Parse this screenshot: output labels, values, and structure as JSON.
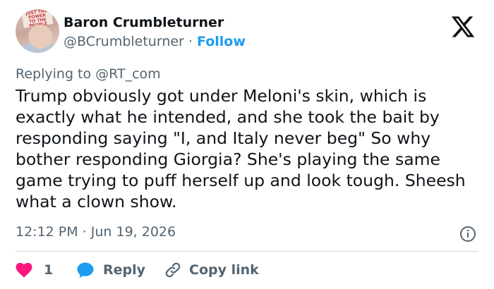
{
  "author": {
    "name": "Baron Crumbleturner",
    "handle": "@BCrumbleturner",
    "separator": " · ",
    "follow_label": "Follow",
    "avatar_sign_text": "JUST THE POWER TO THE PEOPLE"
  },
  "platform": {
    "logo_icon": "x-logo-icon"
  },
  "reply_context": "Replying to @RT_com",
  "tweet": {
    "text": "Trump obviously got under Meloni's skin, which is exactly what he intended, and she took the bait by responding saying \"I, and Italy never beg\" So why bother responding Giorgia? She's playing the same game trying to puff herself up and look tough. Sheesh what a clown show.",
    "timestamp": "12:12 PM · Jun 19, 2026"
  },
  "actions": {
    "like_count": "1",
    "reply_label": "Reply",
    "copy_link_label": "Copy link"
  },
  "colors": {
    "text": "#0f1419",
    "muted": "#536471",
    "accent": "#1d9bf0",
    "like": "#f91880",
    "divider": "#cfd9de"
  }
}
